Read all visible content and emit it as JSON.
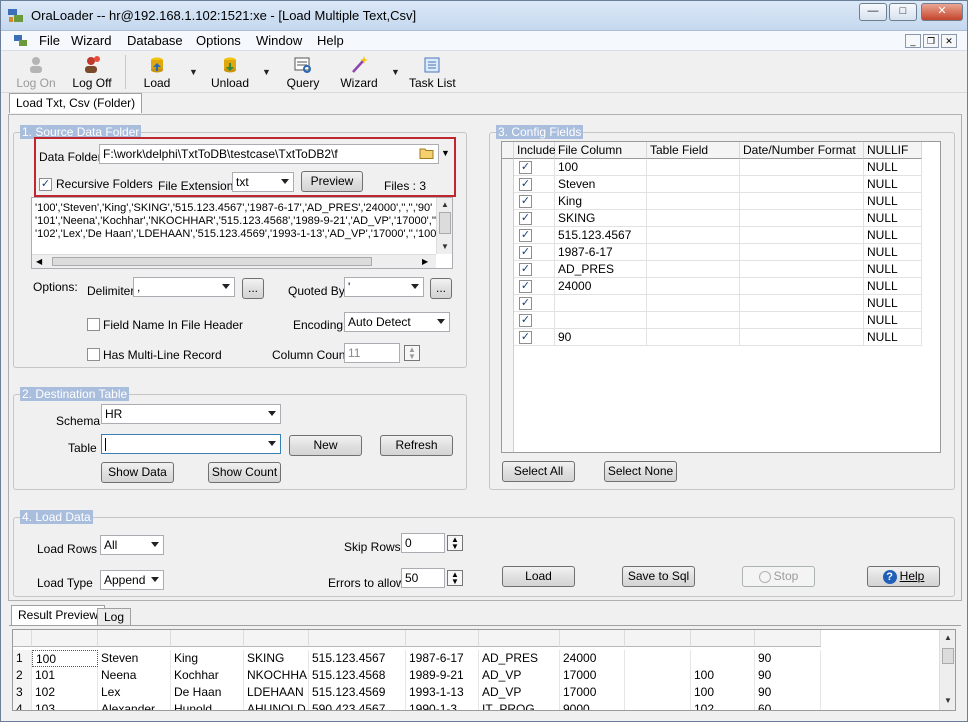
{
  "window": {
    "title": "OraLoader -- hr@192.168.1.102:1521:xe - [Load Multiple Text,Csv]"
  },
  "menu": [
    "File",
    "Wizard",
    "Database",
    "Options",
    "Window",
    "Help"
  ],
  "toolbar": {
    "log_on": "Log On",
    "log_off": "Log Off",
    "load": "Load",
    "unload": "Unload",
    "query": "Query",
    "wizard": "Wizard",
    "task_list": "Task List"
  },
  "main_tab": "Load Txt, Csv (Folder)",
  "source": {
    "legend": "1. Source Data Folder",
    "data_folder_label": "Data Folder",
    "data_folder_value": "F:\\work\\delphi\\TxtToDB\\testcase\\TxtToDB2\\f",
    "recursive_label": "Recursive Folders",
    "ext_label": "File Extension:",
    "ext_value": "txt",
    "preview_button": "Preview",
    "files_count": "Files : 3",
    "preview_lines": [
      "'100','Steven','King','SKING','515.123.4567','1987-6-17','AD_PRES','24000','','','90'",
      "'101','Neena','Kochhar','NKOCHHAR','515.123.4568','1989-9-21','AD_VP','17000','','100','",
      "'102','Lex','De Haan','LDEHAAN','515.123.4569','1993-1-13','AD_VP','17000','','100','"
    ],
    "options_label": "Options:",
    "delimiter_label": "Delimiter",
    "delimiter_value": ",",
    "quoted_label": "Quoted By",
    "quoted_value": "'",
    "field_name_header_label": "Field Name In File Header",
    "encoding_label": "Encoding",
    "encoding_value": "Auto Detect",
    "multiline_label": "Has Multi-Line Record",
    "column_count_label": "Column Count",
    "column_count_value": "11",
    "browse_button": "..."
  },
  "destination": {
    "legend": "2. Destination Table",
    "schema_label": "Schema",
    "schema_value": "HR",
    "table_label": "Table",
    "table_value": "",
    "new_button": "New",
    "refresh_button": "Refresh",
    "show_data_button": "Show Data",
    "show_count_button": "Show Count"
  },
  "config": {
    "legend": "3. Config Fields",
    "headers": [
      "Include",
      "File Column",
      "Table Field",
      "Date/Number Format",
      "NULLIF"
    ],
    "rows": [
      {
        "file_column": "100",
        "table_field": "",
        "format": "",
        "nullif": "NULL"
      },
      {
        "file_column": "Steven",
        "table_field": "",
        "format": "",
        "nullif": "NULL"
      },
      {
        "file_column": "King",
        "table_field": "",
        "format": "",
        "nullif": "NULL"
      },
      {
        "file_column": "SKING",
        "table_field": "",
        "format": "",
        "nullif": "NULL"
      },
      {
        "file_column": "515.123.4567",
        "table_field": "",
        "format": "",
        "nullif": "NULL"
      },
      {
        "file_column": "1987-6-17",
        "table_field": "",
        "format": "",
        "nullif": "NULL"
      },
      {
        "file_column": "AD_PRES",
        "table_field": "",
        "format": "",
        "nullif": "NULL"
      },
      {
        "file_column": "24000",
        "table_field": "",
        "format": "",
        "nullif": "NULL"
      },
      {
        "file_column": "",
        "table_field": "",
        "format": "",
        "nullif": "NULL"
      },
      {
        "file_column": "",
        "table_field": "",
        "format": "",
        "nullif": "NULL"
      },
      {
        "file_column": "90",
        "table_field": "",
        "format": "",
        "nullif": "NULL"
      }
    ],
    "select_all_button": "Select All",
    "select_none_button": "Select None"
  },
  "load_data": {
    "legend": "4. Load Data",
    "load_rows_label": "Load Rows",
    "load_rows_value": "All",
    "load_type_label": "Load Type",
    "load_type_value": "Append",
    "skip_rows_label": "Skip Rows",
    "skip_rows_value": "0",
    "errors_label": "Errors to allow",
    "errors_value": "50",
    "load_button": "Load",
    "save_sql_button": "Save to Sql",
    "stop_button": "Stop",
    "help_button": "Help"
  },
  "result_tabs": [
    "Result Preview",
    "Log"
  ],
  "results": [
    [
      "1",
      "100",
      "Steven",
      "King",
      "SKING",
      "515.123.4567",
      "1987-6-17",
      "AD_PRES",
      "24000",
      "",
      "",
      "90"
    ],
    [
      "2",
      "101",
      "Neena",
      "Kochhar",
      "NKOCHHAR",
      "515.123.4568",
      "1989-9-21",
      "AD_VP",
      "17000",
      "",
      "100",
      "90"
    ],
    [
      "3",
      "102",
      "Lex",
      "De Haan",
      "LDEHAAN",
      "515.123.4569",
      "1993-1-13",
      "AD_VP",
      "17000",
      "",
      "100",
      "90"
    ],
    [
      "4",
      "103",
      "Alexander",
      "Hunold",
      "AHUNOLD",
      "590.423.4567",
      "1990-1-3",
      "IT_PROG",
      "9000",
      "",
      "102",
      "60"
    ]
  ]
}
